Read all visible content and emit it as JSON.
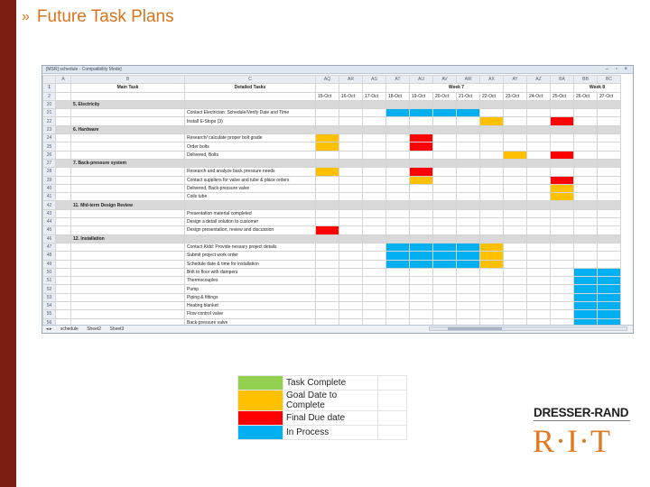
{
  "slide": {
    "bullet": "»",
    "title": "Future Task Plans"
  },
  "window": {
    "title": "[MSR] schedule - Compatibility Mode]",
    "controls": "– ▫ ×"
  },
  "columns": [
    "",
    "A",
    "B",
    "C",
    "AQ",
    "AR",
    "AS",
    "AT",
    "AU",
    "AV",
    "AW",
    "AX",
    "AY",
    "AZ",
    "BA",
    "BB",
    "BC"
  ],
  "headers": {
    "row1": {
      "num": "1",
      "main": "Main Task",
      "detail": "Detailed Tasks",
      "week7": "Week 7",
      "week8": "Week 8"
    },
    "row2": {
      "num": "2",
      "dates": [
        "15-Oct",
        "16-Oct",
        "17-Oct",
        "18-Oct",
        "19-Oct",
        "20-Oct",
        "21-Oct",
        "22-Oct",
        "23-Oct",
        "24-Oct",
        "25-Oct",
        "26-Oct",
        "27-Oct"
      ]
    }
  },
  "rows": [
    {
      "num": "20",
      "main": "5. Electricity",
      "detail": "",
      "cells": [
        "",
        "",
        "",
        "",
        "",
        "",
        "",
        "",
        "",
        "",
        "",
        "",
        ""
      ],
      "type": "section"
    },
    {
      "num": "21",
      "main": "",
      "detail": "Contact Electrician: Schedule/Verify Date and Time",
      "cells": [
        "",
        "",
        "",
        "blue",
        "blue",
        "blue",
        "blue",
        "",
        "",
        "",
        "",
        "",
        ""
      ]
    },
    {
      "num": "22",
      "main": "",
      "detail": "Install E-Stops (3)",
      "cells": [
        "",
        "",
        "",
        "",
        "",
        "",
        "",
        "yellow",
        "",
        "",
        "red",
        "",
        ""
      ]
    },
    {
      "num": "23",
      "main": "6. Hardware",
      "detail": "",
      "cells": [
        "",
        "",
        "",
        "",
        "",
        "",
        "",
        "",
        "",
        "",
        "",
        "",
        ""
      ],
      "type": "section"
    },
    {
      "num": "24",
      "main": "",
      "detail": "Research/ calculate proper bolt grade",
      "cells": [
        "yellow",
        "",
        "",
        "",
        "red",
        "",
        "",
        "",
        "",
        "",
        "",
        "",
        ""
      ]
    },
    {
      "num": "25",
      "main": "",
      "detail": "Order bolts",
      "cells": [
        "yellow",
        "",
        "",
        "",
        "red",
        "",
        "",
        "",
        "",
        "",
        "",
        "",
        ""
      ]
    },
    {
      "num": "26",
      "main": "",
      "detail": "Delivered, Bolts",
      "cells": [
        "",
        "",
        "",
        "",
        "",
        "",
        "",
        "",
        "yellow",
        "",
        "red",
        "",
        ""
      ]
    },
    {
      "num": "27",
      "main": "7. Back-pressure system",
      "detail": "",
      "cells": [
        "",
        "",
        "",
        "",
        "",
        "",
        "",
        "",
        "",
        "",
        "",
        "",
        ""
      ],
      "type": "section"
    },
    {
      "num": "28",
      "main": "",
      "detail": "Research and analyze back pressure needs",
      "cells": [
        "yellow",
        "",
        "",
        "",
        "red",
        "",
        "",
        "",
        "",
        "",
        "",
        "",
        ""
      ]
    },
    {
      "num": "39",
      "main": "",
      "detail": "Contact suppliers for valve and tube & place orders",
      "cells": [
        "",
        "",
        "",
        "",
        "yellow",
        "",
        "",
        "",
        "",
        "",
        "red",
        "",
        ""
      ]
    },
    {
      "num": "40",
      "main": "",
      "detail": "Delivered, Back-pressure valve",
      "cells": [
        "",
        "",
        "",
        "",
        "",
        "",
        "",
        "",
        "",
        "",
        "yellow",
        "",
        ""
      ]
    },
    {
      "num": "41",
      "main": "",
      "detail": "Coils tube",
      "cells": [
        "",
        "",
        "",
        "",
        "",
        "",
        "",
        "",
        "",
        "",
        "yellow",
        "",
        ""
      ]
    },
    {
      "num": "42",
      "main": "11. Mid-term Design Review",
      "detail": "",
      "cells": [
        "",
        "",
        "",
        "",
        "",
        "",
        "",
        "",
        "",
        "",
        "",
        "",
        ""
      ],
      "type": "section"
    },
    {
      "num": "43",
      "main": "",
      "detail": "Presentation material completed",
      "cells": [
        "",
        "",
        "",
        "",
        "",
        "",
        "",
        "",
        "",
        "",
        "",
        "",
        ""
      ]
    },
    {
      "num": "44",
      "main": "",
      "detail": "Design a detail solution to customer",
      "cells": [
        "",
        "",
        "",
        "",
        "",
        "",
        "",
        "",
        "",
        "",
        "",
        "",
        ""
      ]
    },
    {
      "num": "45",
      "main": "",
      "detail": "Design presentation, review and discussion",
      "cells": [
        "red",
        "",
        "",
        "",
        "",
        "",
        "",
        "",
        "",
        "",
        "",
        "",
        ""
      ]
    },
    {
      "num": "46",
      "main": "12. Installation",
      "detail": "",
      "cells": [
        "",
        "",
        "",
        "",
        "",
        "",
        "",
        "",
        "",
        "",
        "",
        "",
        ""
      ],
      "type": "section"
    },
    {
      "num": "47",
      "main": "",
      "detail": "Contact Kidd: Provide nessary project details",
      "cells": [
        "",
        "",
        "",
        "blue",
        "blue",
        "blue",
        "blue",
        "yellow",
        "",
        "",
        "",
        "",
        ""
      ]
    },
    {
      "num": "48",
      "main": "",
      "detail": "Submit project work order",
      "cells": [
        "",
        "",
        "",
        "blue",
        "blue",
        "blue",
        "blue",
        "yellow",
        "",
        "",
        "",
        "",
        ""
      ]
    },
    {
      "num": "49",
      "main": "",
      "detail": "Schedule date & time for installation",
      "cells": [
        "",
        "",
        "",
        "blue",
        "blue",
        "blue",
        "blue",
        "yellow",
        "",
        "",
        "",
        "",
        ""
      ]
    },
    {
      "num": "50",
      "main": "",
      "detail": "Bolt to floor with dampers",
      "cells": [
        "",
        "",
        "",
        "",
        "",
        "",
        "",
        "",
        "",
        "",
        "",
        "blue",
        "blue"
      ]
    },
    {
      "num": "51",
      "main": "",
      "detail": "Thermocouples",
      "cells": [
        "",
        "",
        "",
        "",
        "",
        "",
        "",
        "",
        "",
        "",
        "",
        "blue",
        "blue"
      ]
    },
    {
      "num": "52",
      "main": "",
      "detail": "Pump",
      "cells": [
        "",
        "",
        "",
        "",
        "",
        "",
        "",
        "",
        "",
        "",
        "",
        "blue",
        "blue"
      ]
    },
    {
      "num": "53",
      "main": "",
      "detail": "Piping & fittings",
      "cells": [
        "",
        "",
        "",
        "",
        "",
        "",
        "",
        "",
        "",
        "",
        "",
        "blue",
        "blue"
      ]
    },
    {
      "num": "54",
      "main": "",
      "detail": "Heating blanket",
      "cells": [
        "",
        "",
        "",
        "",
        "",
        "",
        "",
        "",
        "",
        "",
        "",
        "blue",
        "blue"
      ]
    },
    {
      "num": "55",
      "main": "",
      "detail": "Flow control valve",
      "cells": [
        "",
        "",
        "",
        "",
        "",
        "",
        "",
        "",
        "",
        "",
        "",
        "blue",
        "blue"
      ]
    },
    {
      "num": "56",
      "main": "",
      "detail": "Back-pressure valve",
      "cells": [
        "",
        "",
        "",
        "",
        "",
        "",
        "",
        "",
        "",
        "",
        "",
        "blue",
        "blue"
      ]
    }
  ],
  "sheet_tabs": [
    "schedule",
    "Sheet2",
    "Sheet3"
  ],
  "colors": {
    "green": "#92d050",
    "yellow": "#ffc000",
    "red": "#ff0000",
    "blue": "#00b0f0",
    "accent": "#d9731c",
    "sidebar": "#7a1f10"
  },
  "legend": [
    {
      "color": "green",
      "label": "Task Complete"
    },
    {
      "color": "yellow",
      "label": "Goal Date to Complete"
    },
    {
      "color": "red",
      "label": "Final Due date"
    },
    {
      "color": "blue",
      "label": "In Process"
    }
  ],
  "logos": {
    "dresser_rand": "DRESSER-RAND",
    "rit": "R·I·T"
  }
}
